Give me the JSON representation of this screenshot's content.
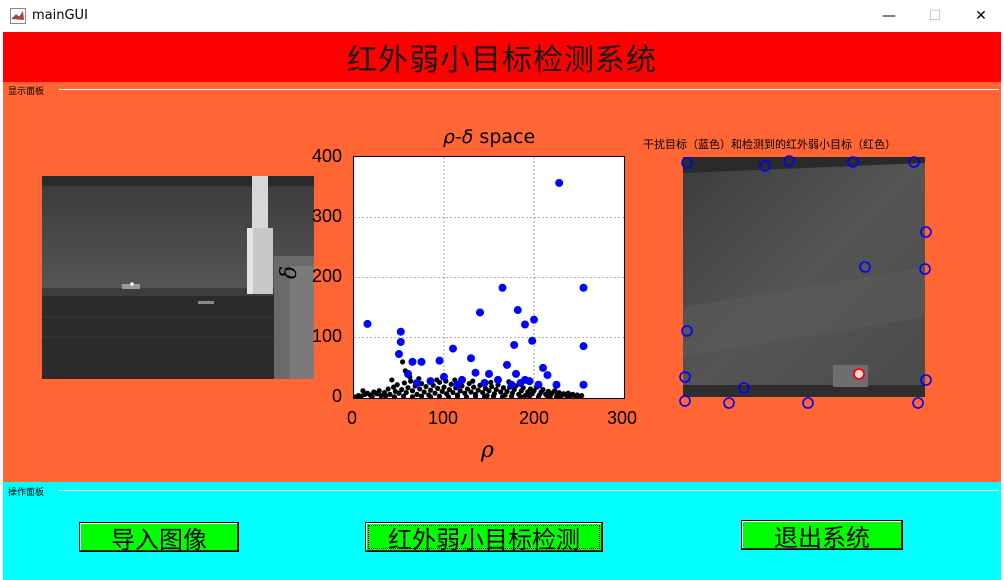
{
  "window": {
    "title": "mainGUI",
    "minimize_glyph": "—",
    "maximize_glyph": "☐",
    "close_glyph": "✕"
  },
  "header": {
    "title": "红外弱小目标检测系统",
    "color": "#ff0000"
  },
  "display_panel": {
    "label": "显示面板",
    "color": "#ff6633",
    "right_caption": "干扰目标（蓝色）和检测到的红外弱小目标（红色）"
  },
  "operation_panel": {
    "label": "操作面板",
    "color": "#00ffff",
    "buttons": [
      {
        "label": "导入图像"
      },
      {
        "label": "红外弱小目标检测"
      },
      {
        "label": "退出系统"
      }
    ],
    "button_color": "#00ff00"
  },
  "chart_data": {
    "type": "scatter",
    "title_symbol_a": "ρ",
    "title_dash": "-",
    "title_symbol_b": "δ",
    "title_suffix": " space",
    "xlabel": "ρ",
    "ylabel": "δ",
    "xlim": [
      0,
      300
    ],
    "ylim": [
      0,
      400
    ],
    "x_ticks": [
      "0",
      "100",
      "200",
      "300"
    ],
    "y_ticks": [
      "0",
      "100",
      "200",
      "300",
      "400"
    ],
    "grid": true,
    "series": [
      {
        "color": "#0000ff",
        "points": [
          [
            228,
            357
          ],
          [
            15,
            123
          ],
          [
            52,
            110
          ],
          [
            52,
            93
          ],
          [
            50,
            73
          ],
          [
            65,
            60
          ],
          [
            75,
            60
          ],
          [
            95,
            62
          ],
          [
            110,
            82
          ],
          [
            130,
            66
          ],
          [
            140,
            142
          ],
          [
            165,
            183
          ],
          [
            178,
            88
          ],
          [
            182,
            146
          ],
          [
            190,
            122
          ],
          [
            200,
            130
          ],
          [
            198,
            95
          ],
          [
            255,
            183
          ],
          [
            255,
            86
          ],
          [
            255,
            22
          ],
          [
            180,
            40
          ],
          [
            170,
            55
          ],
          [
            150,
            40
          ],
          [
            135,
            42
          ],
          [
            120,
            30
          ],
          [
            100,
            35
          ],
          [
            85,
            28
          ],
          [
            210,
            50
          ],
          [
            215,
            38
          ],
          [
            225,
            22
          ],
          [
            185,
            25
          ],
          [
            190,
            30
          ],
          [
            160,
            30
          ],
          [
            145,
            25
          ],
          [
            205,
            22
          ],
          [
            60,
            40
          ],
          [
            195,
            28
          ],
          [
            175,
            22
          ],
          [
            115,
            22
          ],
          [
            70,
            25
          ]
        ]
      },
      {
        "color": "#000000",
        "points": [
          [
            2,
            2
          ],
          [
            5,
            4
          ],
          [
            8,
            3
          ],
          [
            12,
            6
          ],
          [
            15,
            8
          ],
          [
            18,
            5
          ],
          [
            22,
            10
          ],
          [
            25,
            7
          ],
          [
            28,
            12
          ],
          [
            30,
            4
          ],
          [
            34,
            9
          ],
          [
            38,
            15
          ],
          [
            40,
            6
          ],
          [
            44,
            18
          ],
          [
            46,
            11
          ],
          [
            48,
            22
          ],
          [
            50,
            8
          ],
          [
            53,
            14
          ],
          [
            56,
            25
          ],
          [
            58,
            9
          ],
          [
            60,
            17
          ],
          [
            63,
            28
          ],
          [
            65,
            12
          ],
          [
            68,
            20
          ],
          [
            70,
            6
          ],
          [
            73,
            15
          ],
          [
            75,
            24
          ],
          [
            78,
            10
          ],
          [
            80,
            19
          ],
          [
            83,
            5
          ],
          [
            85,
            13
          ],
          [
            88,
            21
          ],
          [
            90,
            8
          ],
          [
            93,
            16
          ],
          [
            95,
            26
          ],
          [
            98,
            11
          ],
          [
            100,
            18
          ],
          [
            103,
            7
          ],
          [
            106,
            14
          ],
          [
            108,
            23
          ],
          [
            110,
            9
          ],
          [
            113,
            17
          ],
          [
            115,
            5
          ],
          [
            118,
            12
          ],
          [
            120,
            20
          ],
          [
            123,
            8
          ],
          [
            126,
            15
          ],
          [
            128,
            24
          ],
          [
            130,
            10
          ],
          [
            133,
            18
          ],
          [
            135,
            6
          ],
          [
            138,
            13
          ],
          [
            140,
            21
          ],
          [
            143,
            9
          ],
          [
            146,
            16
          ],
          [
            148,
            4
          ],
          [
            150,
            12
          ],
          [
            153,
            19
          ],
          [
            156,
            7
          ],
          [
            158,
            14
          ],
          [
            160,
            22
          ],
          [
            163,
            10
          ],
          [
            166,
            17
          ],
          [
            168,
            5
          ],
          [
            170,
            11
          ],
          [
            173,
            18
          ],
          [
            176,
            8
          ],
          [
            178,
            14
          ],
          [
            180,
            20
          ],
          [
            183,
            6
          ],
          [
            186,
            12
          ],
          [
            188,
            17
          ],
          [
            190,
            4
          ],
          [
            193,
            10
          ],
          [
            196,
            15
          ],
          [
            198,
            7
          ],
          [
            200,
            12
          ],
          [
            203,
            18
          ],
          [
            206,
            5
          ],
          [
            208,
            10
          ],
          [
            210,
            14
          ],
          [
            213,
            6
          ],
          [
            216,
            11
          ],
          [
            218,
            3
          ],
          [
            220,
            8
          ],
          [
            223,
            12
          ],
          [
            226,
            5
          ],
          [
            228,
            9
          ],
          [
            230,
            3
          ],
          [
            233,
            7
          ],
          [
            236,
            4
          ],
          [
            238,
            8
          ],
          [
            240,
            2
          ],
          [
            243,
            6
          ],
          [
            246,
            3
          ],
          [
            248,
            5
          ],
          [
            250,
            2
          ],
          [
            253,
            4
          ],
          [
            20,
            2
          ],
          [
            35,
            3
          ],
          [
            45,
            2
          ],
          [
            55,
            3
          ],
          [
            65,
            2
          ],
          [
            75,
            3
          ],
          [
            85,
            2
          ],
          [
            95,
            3
          ],
          [
            105,
            2
          ],
          [
            115,
            3
          ],
          [
            125,
            2
          ],
          [
            135,
            3
          ],
          [
            145,
            2
          ],
          [
            155,
            3
          ],
          [
            165,
            2
          ],
          [
            175,
            3
          ],
          [
            185,
            2
          ],
          [
            195,
            3
          ],
          [
            205,
            2
          ],
          [
            215,
            3
          ],
          [
            225,
            2
          ],
          [
            10,
            12
          ],
          [
            42,
            30
          ],
          [
            62,
            35
          ],
          [
            72,
            32
          ],
          [
            92,
            30
          ],
          [
            102,
            28
          ],
          [
            112,
            30
          ],
          [
            132,
            28
          ],
          [
            152,
            26
          ],
          [
            172,
            27
          ],
          [
            54,
            60
          ],
          [
            57,
            45
          ]
        ]
      }
    ]
  },
  "right_markers": {
    "blue_color": "#0000ff",
    "red_color": "#ff0000",
    "blue": [
      [
        4,
        6
      ],
      [
        82,
        9
      ],
      [
        106,
        4
      ],
      [
        170,
        5
      ],
      [
        231,
        5
      ],
      [
        243,
        75
      ],
      [
        242,
        112
      ],
      [
        182,
        110
      ],
      [
        4,
        174
      ],
      [
        2,
        220
      ],
      [
        61,
        231
      ],
      [
        243,
        223
      ],
      [
        2,
        244
      ],
      [
        46,
        246
      ],
      [
        125,
        246
      ],
      [
        235,
        246
      ]
    ],
    "red": [
      [
        176,
        217
      ]
    ]
  }
}
